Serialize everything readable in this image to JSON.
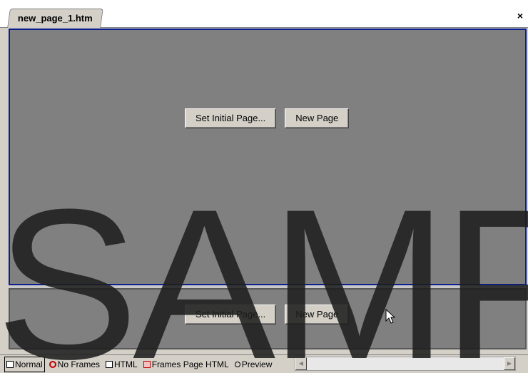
{
  "tab": {
    "title": "new_page_1.htm",
    "close_glyph": "×"
  },
  "top_frame": {
    "set_initial_page_label": "Set Initial Page...",
    "new_page_label": "New Page"
  },
  "bottom_frame": {
    "set_initial_page_label": "Set Initial Page...",
    "new_page_label": "New Page"
  },
  "view_tabs": [
    {
      "label": "Normal",
      "icon": "normal-view-icon",
      "active": true
    },
    {
      "label": "No Frames",
      "icon": "no-frames-icon",
      "active": false
    },
    {
      "label": "HTML",
      "icon": "html-view-icon",
      "active": false
    },
    {
      "label": "Frames Page HTML",
      "icon": "frames-page-html-icon",
      "active": false
    },
    {
      "label": "Preview",
      "icon": "preview-icon",
      "active": false
    }
  ],
  "watermark": {
    "text": "SAMPLE"
  },
  "colors": {
    "frame_background": "#808080",
    "selected_frame_border": "#0a1f8f",
    "chrome": "#d4d0c8"
  }
}
